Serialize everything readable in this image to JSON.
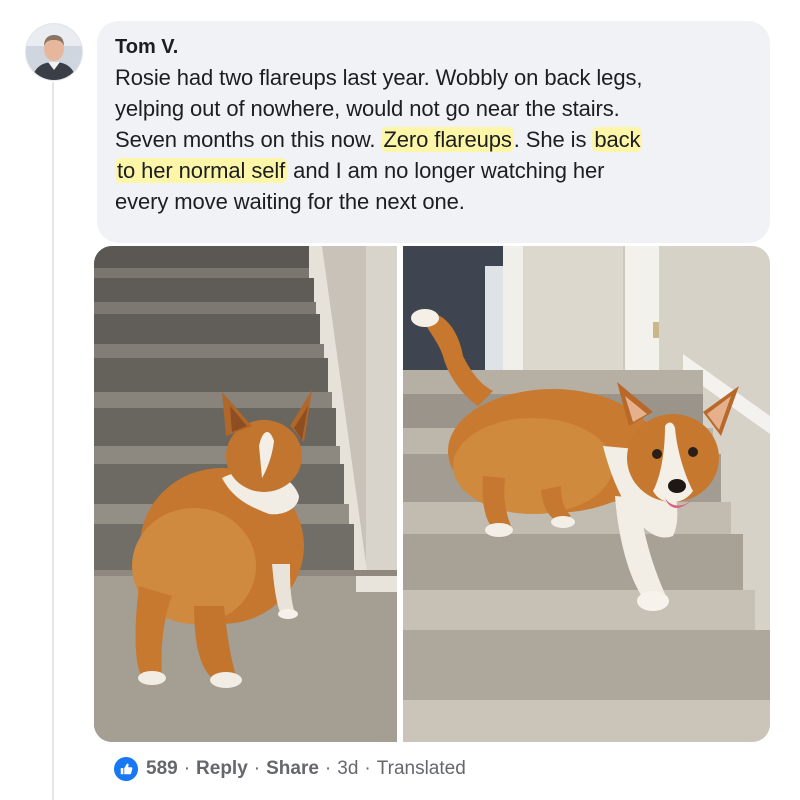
{
  "comment": {
    "author": "Tom V.",
    "lines": [
      [
        "Rosie had two flareups last year. Wobbly on back legs,"
      ],
      [
        "yelping out of nowhere, would not go near the stairs."
      ],
      [
        "Seven months on this now. ",
        "Zero flareups",
        ". She is ",
        "back"
      ],
      [
        "to her normal self",
        " and I am no longer watching her"
      ],
      [
        "every move waiting for the next one."
      ]
    ],
    "highlight_color": "#fdf6a8"
  },
  "photos": {
    "left_icon": "corgi-facing-stairs",
    "right_icon": "corgi-walking-down-stairs"
  },
  "actions": {
    "like_icon": "thumbs-up-icon",
    "like_count": "589",
    "reply_label": "Reply",
    "share_label": "Share",
    "time": "3d",
    "translated_label": "Translated",
    "separator": "·"
  },
  "colors": {
    "bubble_bg": "#f0f2f5",
    "like_blue": "#1877f2",
    "meta_gray": "#65676b"
  }
}
